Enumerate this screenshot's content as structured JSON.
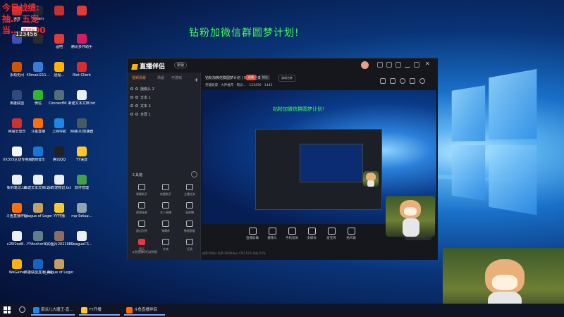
{
  "desktop": {
    "banner": "钻粉加微信群圆梦计划!",
    "overlay": {
      "line1": "今日战绩:",
      "line2": "抽…  五宠",
      "line3": "当…  1700",
      "room_tag": "房间号",
      "room_num": "123456"
    },
    "icons": [
      {
        "label": "语音",
        "color": "#c9302c"
      },
      {
        "label": "Steam",
        "color": "#1b2838"
      },
      {
        "label": "",
        "color": "#c9302c"
      },
      {
        "label": "",
        "color": "#e53935"
      },
      {
        "label": "",
        "color": "#3f51b5"
      },
      {
        "label": "",
        "color": "#2b2b2b"
      },
      {
        "label": "酒吧",
        "color": "#e53935"
      },
      {
        "label": "腾讯多开助手",
        "color": "#d81b60"
      },
      {
        "label": "永劫无间",
        "color": "#d35400"
      },
      {
        "label": "40maki211…",
        "color": "#3a7bd5"
      },
      {
        "label": "远程…",
        "color": "#ffb300"
      },
      {
        "label": "Riot Client",
        "color": "#d32f2f"
      },
      {
        "label": "英雄联盟",
        "color": "#2e4a7a"
      },
      {
        "label": "微信",
        "color": "#2eb82e"
      },
      {
        "label": "ConnectM…",
        "color": "#546e7a"
      },
      {
        "label": "新建文本文档.txt",
        "color": "#eceff1"
      },
      {
        "label": "网易云音乐",
        "color": "#d32f2f"
      },
      {
        "label": "斗鱼直播",
        "color": "#ff6f00"
      },
      {
        "label": "上网导航",
        "color": "#1e88e5"
      },
      {
        "label": "网易UU加速器",
        "color": "#455a64"
      },
      {
        "label": "XX355区切专用版.exe",
        "color": "#f5f5f5"
      },
      {
        "label": "酷狗音乐",
        "color": "#1976d2"
      },
      {
        "label": "腾讯QQ",
        "color": "#212121"
      },
      {
        "label": "YY语音",
        "color": "#ffca28"
      },
      {
        "label": "新的笔记.txt",
        "color": "#eceff1"
      },
      {
        "label": "新建文本文档(2).txt",
        "color": "#eceff1"
      },
      {
        "label": "小鸡宠物记.txt",
        "color": "#eceff1"
      },
      {
        "label": "软件管理",
        "color": "#43a047"
      },
      {
        "label": "斗鱼直播伴侣",
        "color": "#ff6f00"
      },
      {
        "label": "League of Legends",
        "color": "#c5a15b"
      },
      {
        "label": "YY开播",
        "color": "#ffca28"
      },
      {
        "label": "mp-Setup…",
        "color": "#90a4ae"
      },
      {
        "label": "c25f2ed8…",
        "color": "#eceff1"
      },
      {
        "label": "YYAnchorS…",
        "color": "#607d8b"
      },
      {
        "label": "QQ图片20210826…",
        "color": "#8d6e63"
      },
      {
        "label": "LeagueCS…",
        "color": "#eceff1"
      },
      {
        "label": "WeGame",
        "color": "#ffb300"
      },
      {
        "label": "英雄联盟直播_英雄联盟…",
        "color": "#1565c0"
      },
      {
        "label": "League of Legends…",
        "color": "#c5a15b"
      }
    ]
  },
  "app": {
    "title": "直播伴侣",
    "version": "新版",
    "tabs": [
      "视频场景",
      "场景",
      "可游戏"
    ],
    "sources": [
      "摄像头 2",
      "文本 1",
      "文本 2",
      "全屏 1"
    ],
    "toolbox_title": "工具箱",
    "tools": [
      "弹幕助手",
      "房管助手",
      "主播任务",
      "视频连麦",
      "本人直播",
      "录屏播",
      "超出勿哭",
      "弹幕库",
      "数据面板",
      "音乐",
      "外卖",
      "灯具"
    ],
    "footer_note": "斗鱼直播伴侣说明版",
    "info_line1": "钻粉加微信群圆梦计划 | 玩法大合集!",
    "pills": [
      "在线",
      "粉丝"
    ],
    "game_tag": "游戏名称",
    "info_line2": "英雄联盟 · 大神推荐  ·  南派…  ·  123456  ·  1443",
    "preview_banner": "钻粉加微信群圆梦计划!",
    "controls": [
      "直播屏幕",
      "摄像头",
      "手机投屏",
      "多媒体",
      "麦克风",
      "扬声器"
    ],
    "start_label": "开始直播",
    "status_text": "帧率:60fps  码率:2600kbps  CPU:15%  内存:22%"
  },
  "taskbar": {
    "items": [
      {
        "label": "南派儿大魔王·直…",
        "color": "#1e88e5"
      },
      {
        "label": "YY开播",
        "color": "#ffca28"
      },
      {
        "label": "斗鱼直播伴侣",
        "color": "#ff6f00"
      }
    ]
  }
}
